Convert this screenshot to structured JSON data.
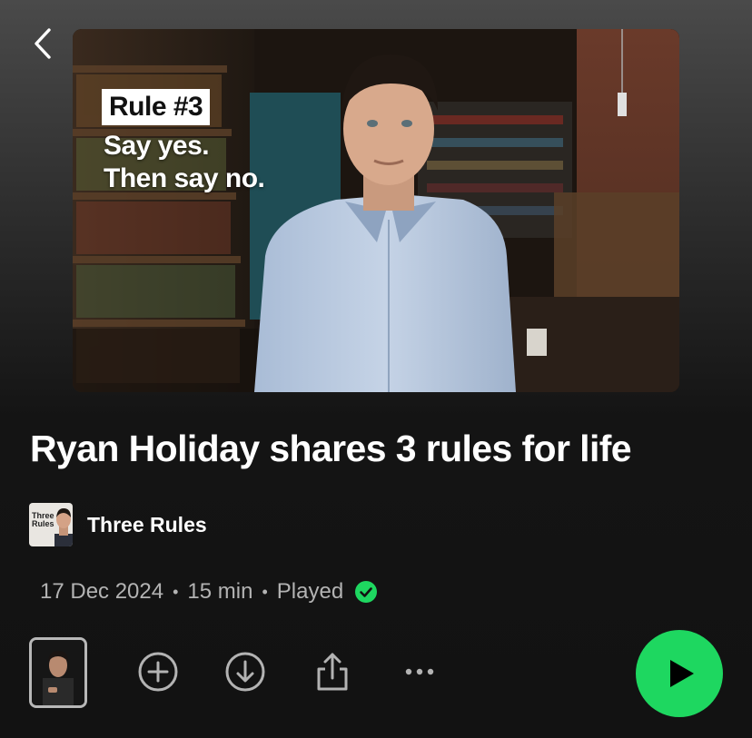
{
  "header": {
    "back_icon": "chevron-left-icon"
  },
  "cover": {
    "badge": "Rule #3",
    "line1": "Say yes.",
    "line2": "Then say no."
  },
  "episode": {
    "title": "Ryan Holiday shares 3 rules for life",
    "show_name": "Three Rules",
    "show_thumb_text": "Three Rules",
    "date": "17 Dec 2024",
    "duration": "15 min",
    "status": "Played"
  },
  "actions": {
    "icons": [
      "episode-thumbnail",
      "add-circle-icon",
      "download-circle-icon",
      "share-icon",
      "more-dots-icon",
      "play-icon"
    ]
  },
  "colors": {
    "accent": "#1ed760",
    "background": "#121212",
    "secondary_text": "#b3b3b3"
  }
}
